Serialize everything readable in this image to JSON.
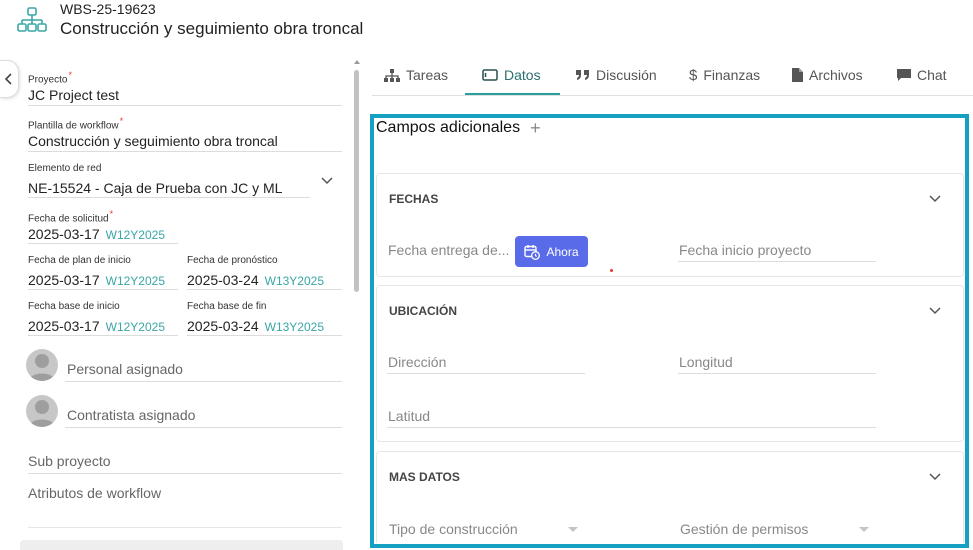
{
  "header": {
    "code": "WBS-25-19623",
    "title": "Construcción y seguimiento obra troncal",
    "icon": "hierarchy-icon",
    "accent": "#3aa6a6"
  },
  "left": {
    "proyecto": {
      "label": "Proyecto",
      "value": "JC Project test"
    },
    "plantilla": {
      "label": "Plantilla de workflow",
      "value": "Construcción y seguimiento obra troncal"
    },
    "elemento": {
      "label": "Elemento de red",
      "value": "NE-15524 - Caja de Prueba con JC y ML"
    },
    "solicitud": {
      "label": "Fecha de solicitud",
      "date": "2025-03-17",
      "week": "W12Y2025"
    },
    "plan_inicio": {
      "label": "Fecha de plan de inicio",
      "date": "2025-03-17",
      "week": "W12Y2025"
    },
    "pronostico": {
      "label": "Fecha de pronóstico",
      "date": "2025-03-24",
      "week": "W13Y2025"
    },
    "base_inicio": {
      "label": "Fecha base de inicio",
      "date": "2025-03-17",
      "week": "W12Y2025"
    },
    "base_fin": {
      "label": "Fecha base de fin",
      "date": "2025-03-24",
      "week": "W13Y2025"
    },
    "personal": "Personal asignado",
    "contratista": "Contratista asignado",
    "sub_proyecto": "Sub proyecto",
    "atributos": "Atributos de workflow",
    "required_mark": "*"
  },
  "tabs": [
    {
      "label": "Tareas",
      "icon": "sitemap-icon"
    },
    {
      "label": "Datos",
      "icon": "window-icon"
    },
    {
      "label": "Discusión",
      "icon": "quote-icon"
    },
    {
      "label": "Finanzas",
      "icon": "dollar-icon"
    },
    {
      "label": "Archivos",
      "icon": "file-icon"
    },
    {
      "label": "Chat",
      "icon": "chat-icon"
    }
  ],
  "active_tab": "Datos",
  "main": {
    "section_title": "Campos adicionales",
    "add_symbol": "+",
    "highlight_color": "#14a0c0",
    "fechas": {
      "title": "FECHAS",
      "fecha_entrega": "Fecha entrega de...",
      "ahora_label": "Ahora",
      "fecha_inicio": "Fecha inicio proyecto"
    },
    "ubicacion": {
      "title": "UBICACIÓN",
      "direccion": "Dirección",
      "longitud": "Longitud",
      "latitud": "Latitud"
    },
    "mas_datos": {
      "title": "MAS DATOS",
      "tipo": "Tipo de construcción",
      "gestion": "Gestión de permisos"
    },
    "button_color": "#5a6bea"
  }
}
